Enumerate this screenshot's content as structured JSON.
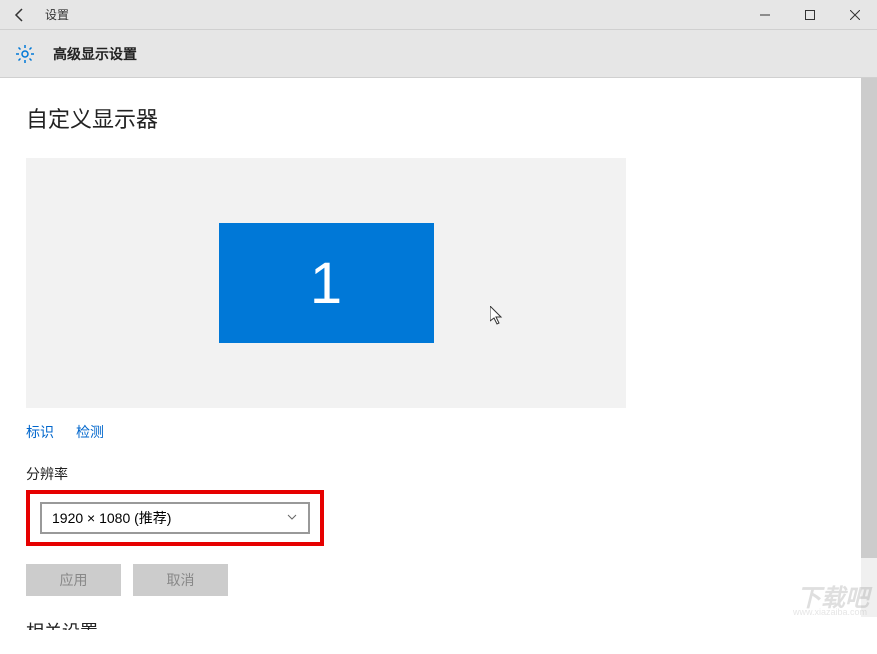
{
  "titlebar": {
    "app_title": "设置"
  },
  "header": {
    "title": "高级显示设置"
  },
  "main": {
    "page_title": "自定义显示器",
    "monitor_number": "1",
    "links": {
      "identify": "标识",
      "detect": "检测"
    },
    "resolution": {
      "label": "分辨率",
      "selected": "1920 × 1080 (推荐)"
    },
    "buttons": {
      "apply": "应用",
      "cancel": "取消"
    },
    "next_section": "相关设置"
  },
  "watermark": {
    "main": "下载吧",
    "url": "www.xiazaiba.com"
  }
}
